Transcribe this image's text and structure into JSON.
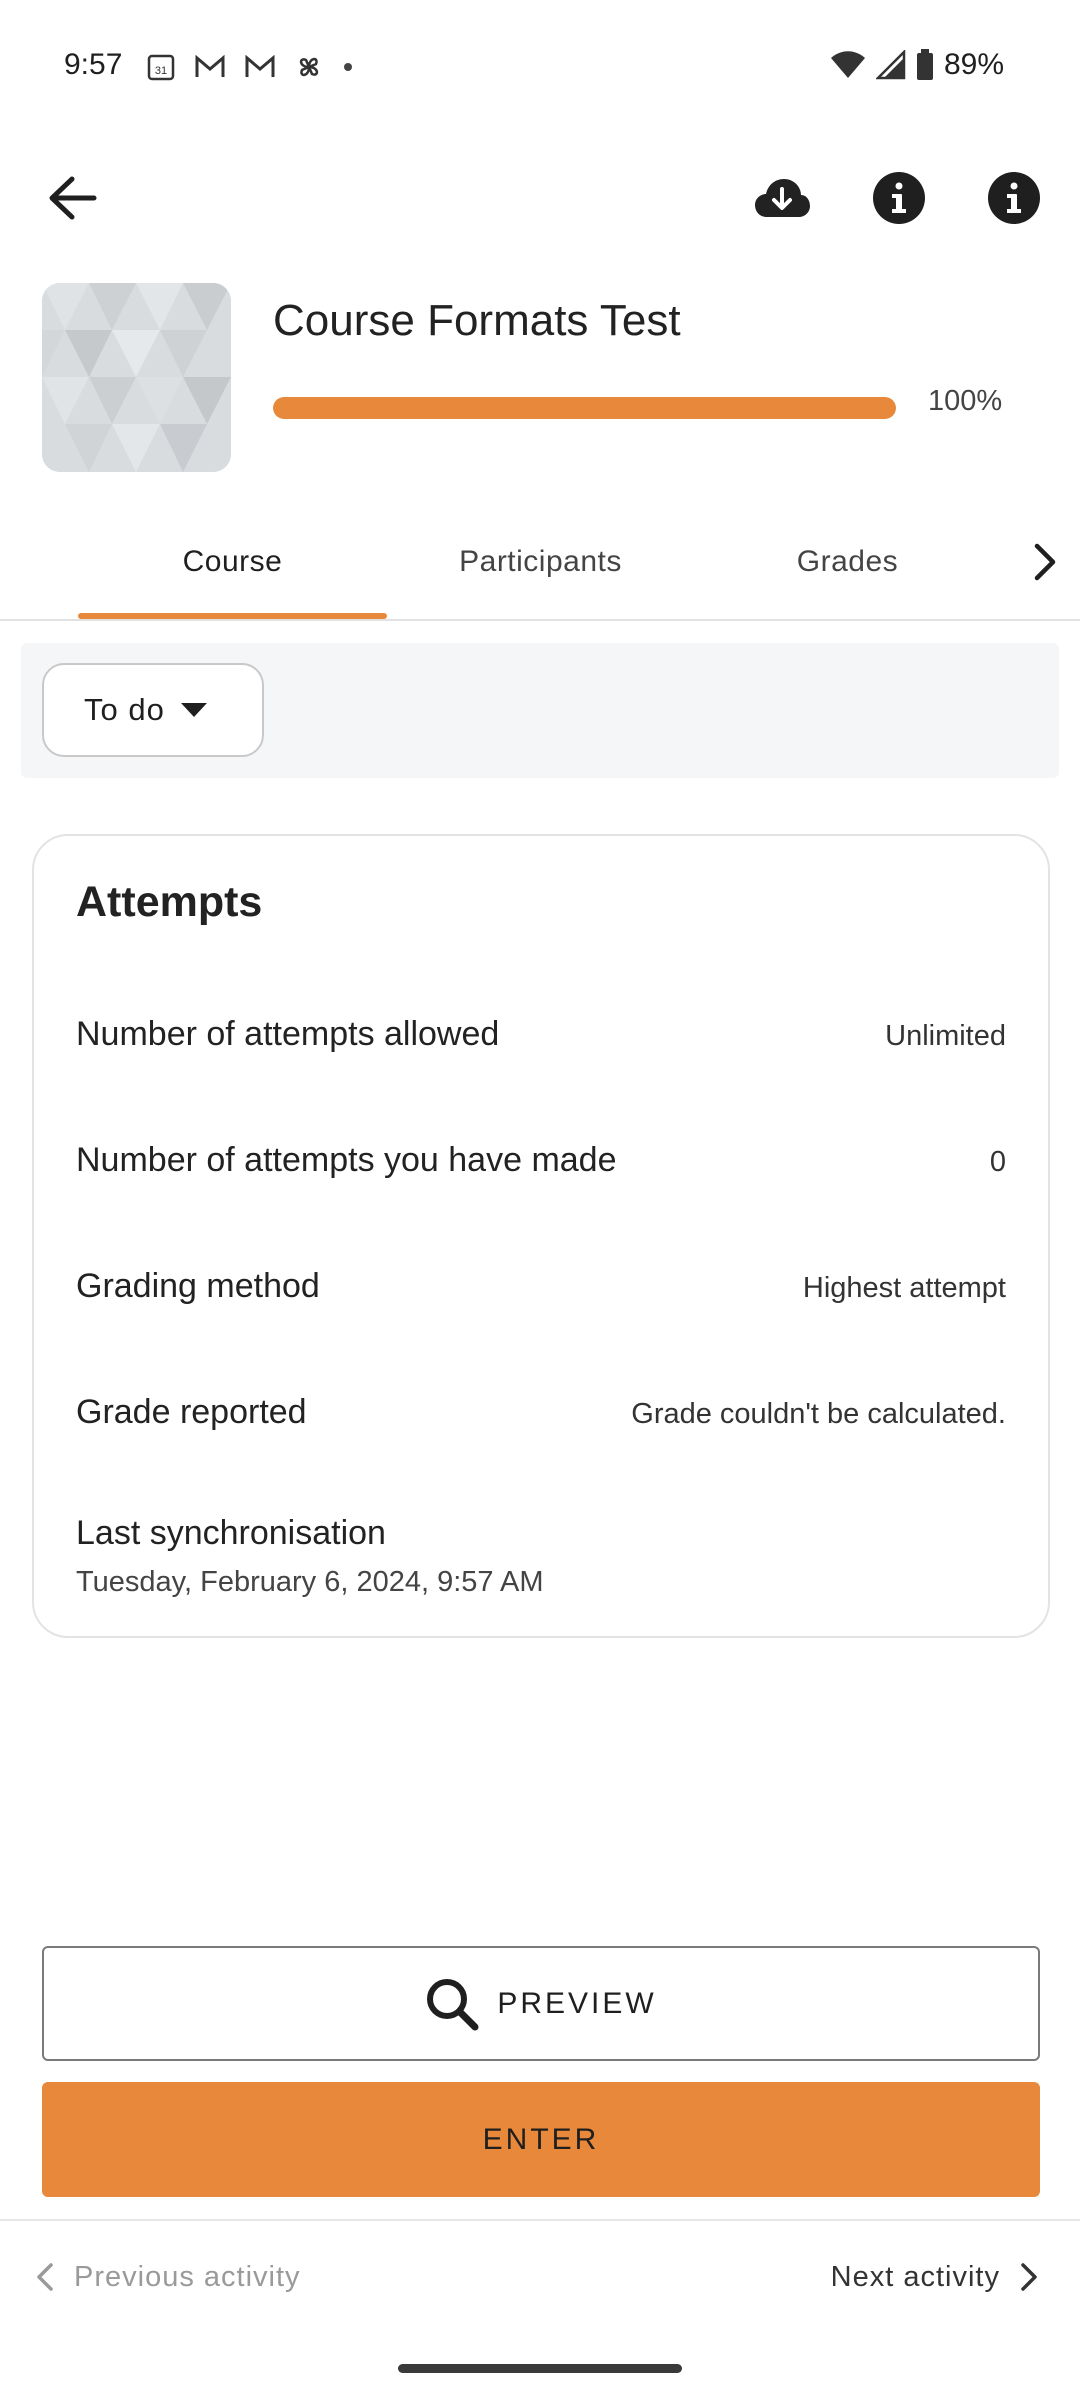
{
  "status_bar": {
    "time": "9:57",
    "battery": "89%",
    "icons_left": [
      "calendar-icon",
      "gmail-icon",
      "gmail-icon",
      "pinwheel-icon",
      "dot-icon"
    ],
    "icons_right": [
      "wifi-icon",
      "signal-icon",
      "battery-icon"
    ]
  },
  "topbar": {
    "icons": [
      "back-arrow-icon",
      "cloud-download-icon",
      "info-icon",
      "info-icon"
    ]
  },
  "course": {
    "title": "Course Formats Test",
    "progress_label": "100%",
    "progress_value": 100
  },
  "tabs": [
    {
      "label": "Course",
      "active": true
    },
    {
      "label": "Participants",
      "active": false
    },
    {
      "label": "Grades",
      "active": false
    }
  ],
  "filter": {
    "label": "To do"
  },
  "attempts": {
    "title": "Attempts",
    "rows": [
      {
        "label": "Number of attempts allowed",
        "value": "Unlimited"
      },
      {
        "label": "Number of attempts you have made",
        "value": "0"
      },
      {
        "label": "Grading method",
        "value": "Highest attempt"
      },
      {
        "label": "Grade reported",
        "value": "Grade couldn't be calculated."
      }
    ],
    "sync_label": "Last synchronisation",
    "sync_value": "Tuesday, February 6, 2024, 9:57 AM"
  },
  "buttons": {
    "preview": "PREVIEW",
    "enter": "ENTER"
  },
  "nav": {
    "previous": "Previous activity",
    "next": "Next activity"
  },
  "colors": {
    "accent": "#e8883a",
    "filter_bg": "#f5f6f8"
  }
}
